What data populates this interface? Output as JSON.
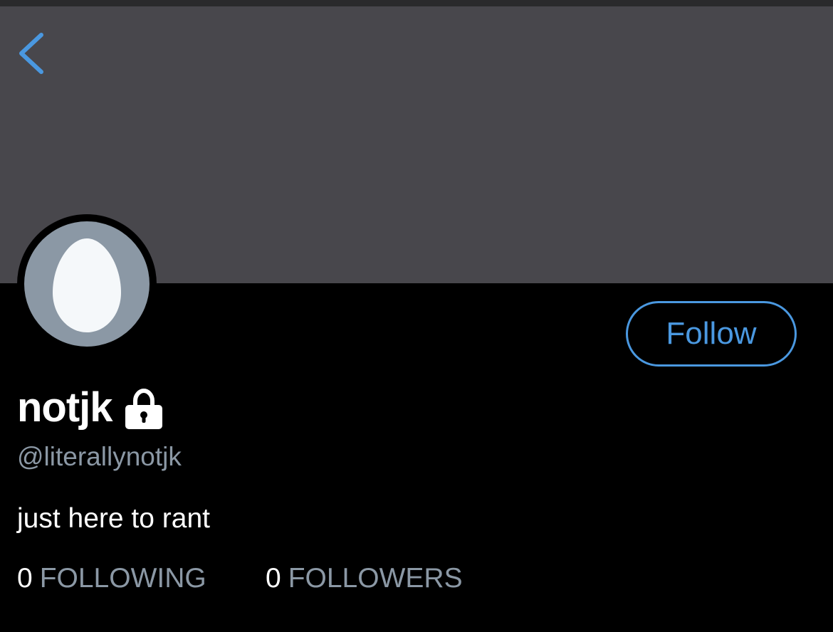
{
  "header": {
    "back_icon": "chevron-left-icon",
    "accent_color": "#4a98e0"
  },
  "banner": {
    "color": "#48474c"
  },
  "profile": {
    "avatar_icon": "default-egg-avatar",
    "display_name": "notjk",
    "protected_icon": "lock-icon",
    "handle": "@literallynotjk",
    "bio": "just here to rant",
    "follow_label": "Follow"
  },
  "stats": {
    "following_count": "0",
    "following_label": "FOLLOWING",
    "followers_count": "0",
    "followers_label": "FOLLOWERS"
  }
}
